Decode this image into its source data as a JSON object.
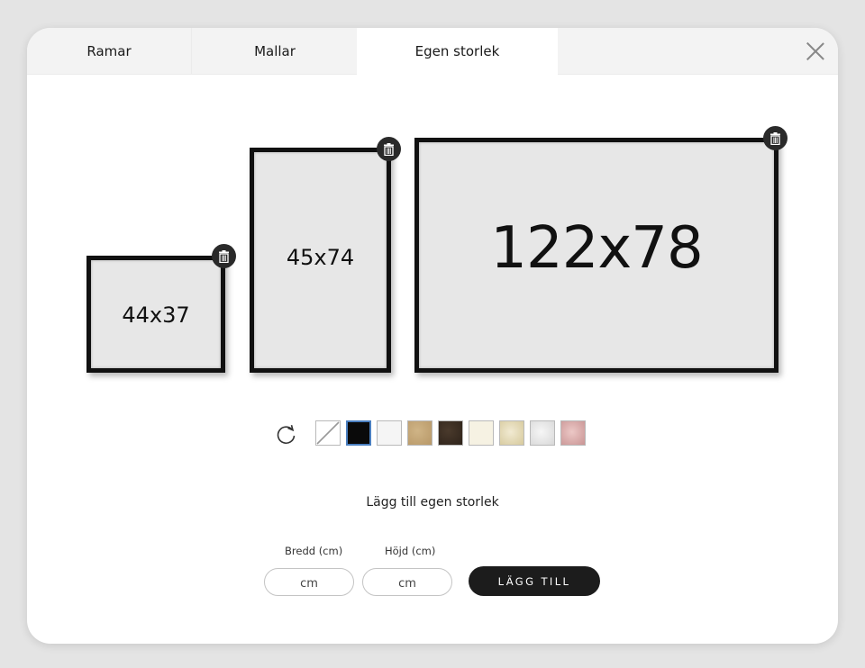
{
  "tabs": [
    {
      "label": "Ramar",
      "active": false
    },
    {
      "label": "Mallar",
      "active": false
    },
    {
      "label": "Egen storlek",
      "active": true
    }
  ],
  "close_icon": "close-icon",
  "frames": [
    {
      "label": "44x37",
      "delete_icon": "trash-icon"
    },
    {
      "label": "45x74",
      "delete_icon": "trash-icon"
    },
    {
      "label": "122x78",
      "delete_icon": "trash-icon"
    }
  ],
  "rotate_icon": "rotate-icon",
  "swatches": [
    {
      "name": "no-frame",
      "color": "#ffffff"
    },
    {
      "name": "black",
      "color": "#0a0a0a",
      "selected": true
    },
    {
      "name": "white",
      "color": "#f5f5f5"
    },
    {
      "name": "oak",
      "color": "#c4a87a"
    },
    {
      "name": "dark-wood",
      "color": "#3c2e22"
    },
    {
      "name": "cream",
      "color": "#f6f2e3"
    },
    {
      "name": "gold",
      "color": "#e2d7b2"
    },
    {
      "name": "silver",
      "color": "#e6e6e6"
    },
    {
      "name": "rose",
      "color": "#d8a8a8"
    }
  ],
  "add_section": {
    "title": "Lägg till egen storlek",
    "width_label": "Bredd (cm)",
    "height_label": "Höjd (cm)",
    "width_placeholder": "cm",
    "height_placeholder": "cm",
    "button_label": "LÄGG TILL"
  }
}
